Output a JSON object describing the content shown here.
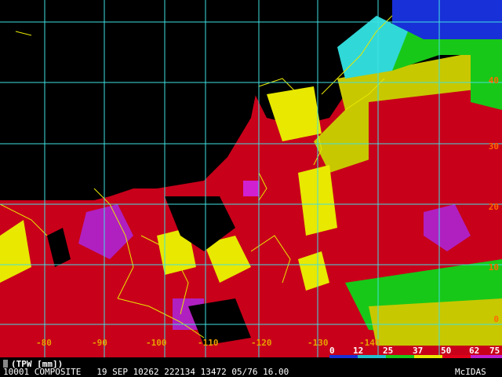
{
  "product": {
    "units_label": "(TPW [mm])",
    "status_line": "10001 COMPOSITE   19 SEP 10262 222134 13472 05/76 16.00",
    "credit": "McIDAS"
  },
  "latitude_labels": [
    "40",
    "30",
    "20",
    "10",
    "0"
  ],
  "longitude_labels": [
    "-80",
    "-90",
    "-100",
    "-110",
    "-120",
    "-130",
    "-140"
  ],
  "legend": {
    "values": [
      "0",
      "12",
      "25",
      "37",
      "50",
      "62",
      "75"
    ],
    "colors": [
      "#1830d8",
      "#20c0d0",
      "#18c818",
      "#e8e800",
      "#e0001a",
      "#c020d0"
    ]
  },
  "colors": {
    "grid": "#40e0e0",
    "coastline": "#e8e800",
    "background": "#000000"
  }
}
